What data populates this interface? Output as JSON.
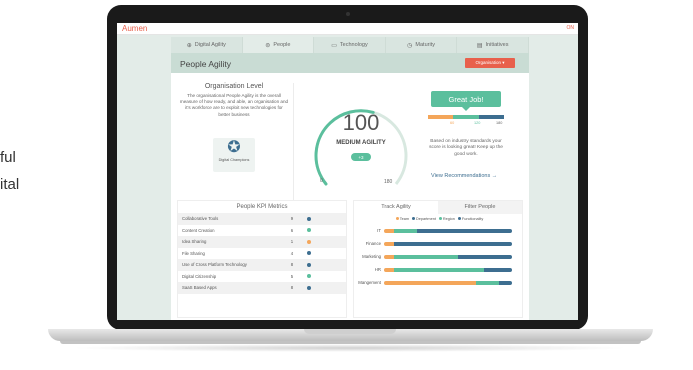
{
  "background_text": [
    "ful",
    "ital"
  ],
  "app": {
    "brand": "Aumen",
    "top_right": "ON"
  },
  "tabs": [
    {
      "label": "Digital Agility",
      "icon": "globe-icon"
    },
    {
      "label": "People",
      "icon": "people-icon"
    },
    {
      "label": "Technology",
      "icon": "monitor-icon"
    },
    {
      "label": "Maturity",
      "icon": "clock-icon"
    },
    {
      "label": "Initiatives",
      "icon": "document-icon"
    }
  ],
  "panel": {
    "title": "People Agility",
    "org_button": "Organisation ▾"
  },
  "org_level": {
    "heading": "Organisation Level",
    "description": "The organisational People Agility is the overall measure of how ready, and able, an organisation and it's workforce are to exploit new technologies for better business",
    "badge_label": "Digital Champions"
  },
  "gauge": {
    "score": "100",
    "label": "MEDIUM AGILITY",
    "delta": "+3",
    "min": "0",
    "max": "180",
    "fraction": 0.56
  },
  "feedback": {
    "banner": "Great Job!",
    "scale_labels": [
      "60",
      "120",
      "180"
    ],
    "message": "Based on industry standards your score is looking great! Keep up the good work.",
    "link": "View Recommendations →"
  },
  "kpi": {
    "title": "People KPI Metrics",
    "rows": [
      {
        "name": "Collaborative Tools",
        "value": "9",
        "color": "#3d6e90"
      },
      {
        "name": "Content Creation",
        "value": "6",
        "color": "#5bbf9d"
      },
      {
        "name": "Idea Sharing",
        "value": "1",
        "color": "#f4a65a"
      },
      {
        "name": "File Sharing",
        "value": "4",
        "color": "#3d6e90"
      },
      {
        "name": "Use of Cross Platform Technology",
        "value": "8",
        "color": "#3d6e90"
      },
      {
        "name": "Digital Citizenship",
        "value": "5",
        "color": "#5bbf9d"
      },
      {
        "name": "SaaS Based Apps",
        "value": "8",
        "color": "#3d6e90"
      }
    ]
  },
  "track": {
    "tabs": [
      "Track Agility",
      "Filter People"
    ],
    "legend": [
      "Team",
      "Department",
      "Region",
      "Functionality"
    ],
    "legend_colors": [
      "#f4a65a",
      "#3d6e90",
      "#5bbf9d",
      "#3d6e90"
    ],
    "rows": [
      {
        "label": "IT",
        "segments": [
          {
            "w": 0.08,
            "c": "#f4a65a"
          },
          {
            "w": 0.18,
            "c": "#5bbf9d"
          },
          {
            "w": 0.74,
            "c": "#3d6e90"
          }
        ]
      },
      {
        "label": "Finance",
        "segments": [
          {
            "w": 0.08,
            "c": "#f4a65a"
          },
          {
            "w": 0.3,
            "c": "#3d6e90"
          },
          {
            "w": 0.62,
            "c": "#3d6e90"
          }
        ]
      },
      {
        "label": "Marketing",
        "segments": [
          {
            "w": 0.08,
            "c": "#f4a65a"
          },
          {
            "w": 0.5,
            "c": "#5bbf9d"
          },
          {
            "w": 0.42,
            "c": "#3d6e90"
          }
        ]
      },
      {
        "label": "HR",
        "segments": [
          {
            "w": 0.08,
            "c": "#f4a65a"
          },
          {
            "w": 0.7,
            "c": "#5bbf9d"
          },
          {
            "w": 0.22,
            "c": "#3d6e90"
          }
        ]
      },
      {
        "label": "Mangement",
        "segments": [
          {
            "w": 0.72,
            "c": "#f4a65a"
          },
          {
            "w": 0.18,
            "c": "#5bbf9d"
          },
          {
            "w": 0.1,
            "c": "#3d6e90"
          }
        ]
      }
    ]
  },
  "colors": {
    "accent": "#e8604c",
    "green": "#5bbf9d",
    "blue": "#3d6e90",
    "orange": "#f4a65a"
  }
}
